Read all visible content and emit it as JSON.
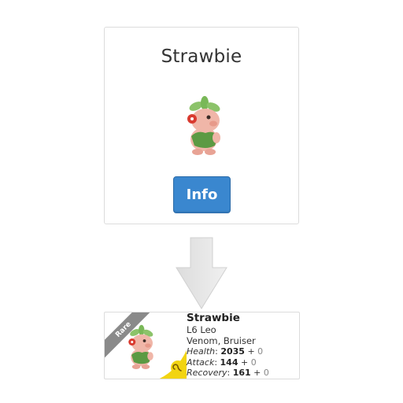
{
  "top_card": {
    "title": "Strawbie",
    "info_button": "Info"
  },
  "bottom_card": {
    "rarity": "Rare",
    "name": "Strawbie",
    "level_sign": "L6 Leo",
    "traits": "Venom, Bruiser",
    "stats": [
      {
        "label": "Health",
        "value": "2035",
        "plus": "+",
        "bonus": "0"
      },
      {
        "label": "Attack",
        "value": "144",
        "plus": "+",
        "bonus": "0"
      },
      {
        "label": "Recovery",
        "value": "161",
        "plus": "+",
        "bonus": "0"
      }
    ]
  },
  "colors": {
    "button": "#3a87cf",
    "ribbon": "#8a8a8a",
    "sign_accent": "#f2d411"
  },
  "icons": {
    "arrow": "down-arrow-icon",
    "sign": "leo-sign-icon"
  }
}
